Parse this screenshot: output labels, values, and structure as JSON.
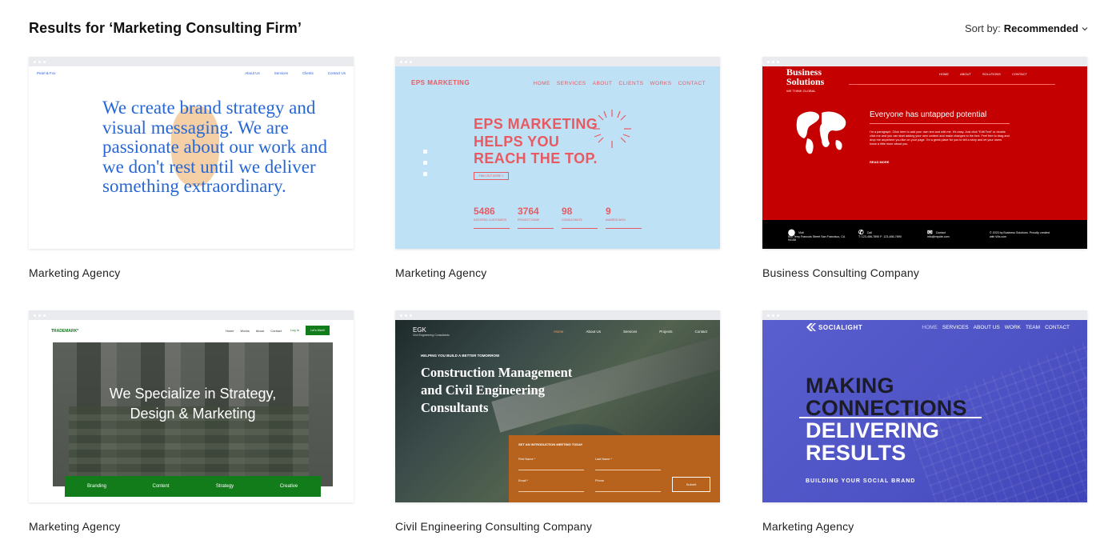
{
  "header": {
    "title": "Results for ‘Marketing Consulting Firm’",
    "sort_label": "Sort by:",
    "sort_value": "Recommended"
  },
  "cards": [
    {
      "caption": "Marketing Agency",
      "preview": {
        "logo": "Pearl & Fox",
        "nav": [
          "About Us",
          "Services",
          "Clients",
          "Contact Us"
        ],
        "headline": "We create brand strategy and visual messaging. We are passionate about our work and we don't rest until we deliver something extraordinary."
      }
    },
    {
      "caption": "Marketing Agency",
      "preview": {
        "logo": "EPS MARKETING",
        "nav": [
          "HOME",
          "SERVICES",
          "ABOUT",
          "CLIENTS",
          "WORKS",
          "CONTACT"
        ],
        "headline_lines": [
          "EPS MARKETING",
          "HELPS YOU",
          "REACH THE TOP."
        ],
        "button": "FIND OUT MORE »",
        "stats": [
          {
            "value": "5486",
            "label": "SATISFIED CUSTOMERS"
          },
          {
            "value": "3764",
            "label": "PROJECT DONE"
          },
          {
            "value": "98",
            "label": "CONSULTANTS"
          },
          {
            "value": "9",
            "label": "AWARDS WON"
          }
        ]
      }
    },
    {
      "caption": "Business Consulting Company",
      "preview": {
        "brand_lines": [
          "Business",
          "Solutions"
        ],
        "tagline": "WE THINK GLOBAL",
        "nav": [
          "HOME",
          "ABOUT",
          "SOLUTIONS",
          "CONTACT"
        ],
        "title": "Everyone has untapped potential",
        "paragraph": "I'm a paragraph. Click here to add your own text and edit me. It's easy. Just click \"Edit Text\" or double click me and you can start adding your own content and make changes to the font. Feel free to drag and drop me anywhere you like on your page. I'm a great place for you to tell a story and let your users know a little more about you.",
        "read_more": "READ MORE",
        "footer": [
          {
            "title": "Visit",
            "text": "500 Terry Francois Street San Francisco, CA 94158"
          },
          {
            "title": "Call",
            "text": "T: 123-456-7890 F: 123-456-7890"
          },
          {
            "title": "Contact",
            "text": "info@mysite.com"
          },
          {
            "title": "",
            "text": "© 2023 by Business Solutions. Proudly created with Wix.com"
          }
        ]
      }
    },
    {
      "caption": "Marketing Agency",
      "preview": {
        "logo": "TRADEMARK*",
        "nav": [
          "Home",
          "Works",
          "About",
          "Contact"
        ],
        "login": "Log In",
        "cta": "Let's Meet!",
        "headline_lines": [
          "We Specialize in Strategy,",
          "Design & Marketing"
        ],
        "tabs": [
          "Branding",
          "Content",
          "Strategy",
          "Creative"
        ]
      }
    },
    {
      "caption": "Civil Engineering Consulting Company",
      "preview": {
        "logo": "EGK",
        "sub": "Civil Engineering Consultants",
        "nav": [
          "Home",
          "About Us",
          "Services",
          "Projects",
          "Contact"
        ],
        "kicker": "HELPING YOU BUILD A BETTER TOMORROW",
        "headline_lines": [
          "Construction Management",
          "and Civil Engineering",
          "Consultants"
        ],
        "form_title": "SET AN INTRODUCTION MEETING TODAY",
        "fields": [
          "First Name *",
          "Last Name *",
          "Email *",
          "Phone"
        ],
        "submit": "Submit"
      }
    },
    {
      "caption": "Marketing Agency",
      "preview": {
        "logo": "SOCIALIGHT",
        "nav": [
          "HOME",
          "SERVICES",
          "ABOUT US",
          "WORK",
          "TEAM",
          "CONTACT"
        ],
        "headline_lines": [
          "MAKING",
          "CONNECTIONS",
          "DELIVERING",
          "RESULTS"
        ],
        "bottom": "BUILDING YOUR SOCIAL BRAND"
      }
    }
  ]
}
